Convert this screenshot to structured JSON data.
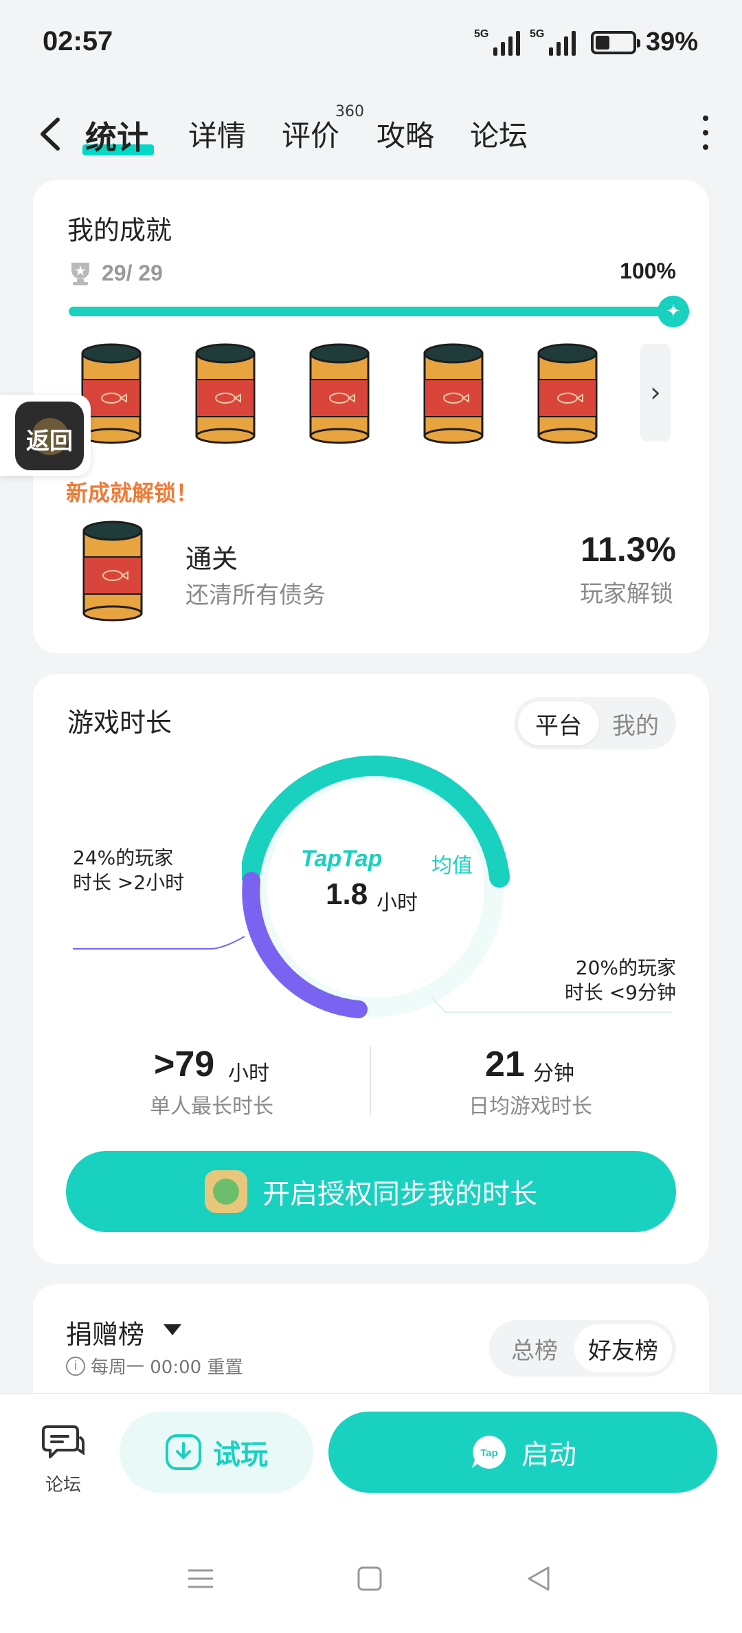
{
  "status_bar": {
    "time": "02:57",
    "signal1_label": "5G",
    "signal2_label": "5G",
    "battery_pct": "39%",
    "battery_level": 0.39
  },
  "nav": {
    "tabs": [
      {
        "label": "统计",
        "active": true
      },
      {
        "label": "详情"
      },
      {
        "label": "评价",
        "badge": "360"
      },
      {
        "label": "攻略"
      },
      {
        "label": "论坛"
      }
    ]
  },
  "achievements": {
    "title": "我的成就",
    "count": "29/ 29",
    "percent": "100%",
    "progress": 1.0,
    "new_unlock_label": "新成就解锁！",
    "unlock": {
      "name": "通关",
      "desc": "还清所有债务",
      "percent": "11.3%",
      "percent_label": "玩家解锁"
    }
  },
  "float_back": {
    "label": "返回"
  },
  "play_time": {
    "title": "游戏时长",
    "toggle": {
      "options": [
        "平台",
        "我的"
      ],
      "selected": "平台"
    },
    "donut": {
      "brand": "TapTap",
      "brand_suffix": "均值",
      "value": "1.8",
      "unit": "小时"
    },
    "annotation_left": {
      "line1": "24%的玩家",
      "line2": "时长 >2小时"
    },
    "annotation_right": {
      "line1": "20%的玩家",
      "line2": "时长 <9分钟"
    },
    "stat_left": {
      "value": ">79",
      "unit": "小时",
      "label": "单人最长时长"
    },
    "stat_right": {
      "value": "21",
      "unit": "分钟",
      "label": "日均游戏时长"
    },
    "auth_button": "开启授权同步我的时长"
  },
  "donation": {
    "title": "捐赠榜",
    "subtitle": "每周一 00:00 重置",
    "toggle": {
      "options": [
        "总榜",
        "好友榜"
      ],
      "selected": "好友榜"
    }
  },
  "bottom_bar": {
    "forum_label": "论坛",
    "trial_label": "试玩",
    "launch_label": "启动",
    "tap_logo": "Tap"
  },
  "colors": {
    "accent": "#19d1bf",
    "purple": "#7a63f0",
    "orange": "#f07a36"
  }
}
